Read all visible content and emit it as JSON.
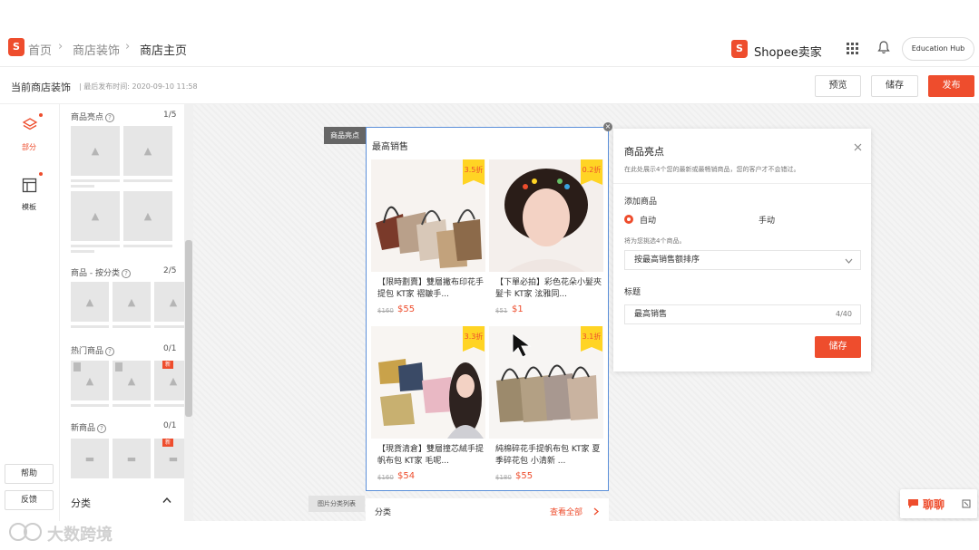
{
  "header": {
    "breadcrumb": [
      "首页",
      "商店装饰",
      "商店主页"
    ],
    "logo_letter": "S",
    "brand": "Shopee卖家",
    "education_hub": "Education Hub"
  },
  "subbar": {
    "title": "当前商店装饰",
    "last_published": "最后发布时间: 2020-09-10 11:58",
    "preview": "预览",
    "save": "储存",
    "publish": "发布"
  },
  "rail": {
    "items": [
      {
        "label": "部分",
        "icon": "layers-icon",
        "active": true
      },
      {
        "label": "模板",
        "icon": "template-icon",
        "active": false
      }
    ],
    "help": "帮助",
    "feedback": "反馈"
  },
  "panel": {
    "sections": [
      {
        "title": "商品亮点",
        "count": "1/5"
      },
      {
        "title": "商品 - 按分类",
        "count": "2/5"
      },
      {
        "title": "热门商品",
        "count": "0/1"
      },
      {
        "title": "新商品",
        "count": "0/1"
      }
    ],
    "category_header": "分类",
    "tag_new": "新"
  },
  "canvas": {
    "section_tag": "商品亮点",
    "list_tag": "图片分类列表",
    "block_title": "最高销售",
    "products": [
      {
        "discount": "3.5折",
        "name": "【限時劃賣】雙層撇布印花手提包 KT家 褶皺手...",
        "old_price": "$160",
        "price": "$55"
      },
      {
        "discount": "0.2折",
        "name": "【下單必拍】彩色花朵小髮夾髮卡 KT家 泫雅同...",
        "old_price": "$51",
        "price": "$1"
      },
      {
        "discount": "3.3折",
        "name": "【現貨清倉】雙層撞芯絨手提帆布包 KT家 毛呢...",
        "old_price": "$160",
        "price": "$54"
      },
      {
        "discount": "3.1折",
        "name": "純棉碎花手提帆布包 KT家 夏季碎花包 小清新 ...",
        "old_price": "$180",
        "price": "$55"
      }
    ],
    "category_label": "分类",
    "view_all": "查看全部"
  },
  "dialog": {
    "title": "商品亮点",
    "desc": "在此处展示4个您的最新或最畅销商品，您的客户才不会错过。",
    "add_label": "添加商品",
    "auto": "自动",
    "manual": "手动",
    "hint": "将为您挑选4个商品。",
    "sort_value": "按最高销售额排序",
    "title_label": "标题",
    "title_value": "最高销售",
    "title_count": "4/40",
    "save": "储存"
  },
  "chat": {
    "label": "聊聊"
  },
  "watermark": "大数跨境",
  "colors": {
    "accent": "#ee4d2d",
    "badge": "#ffd424",
    "selection": "#5b8fd9"
  }
}
